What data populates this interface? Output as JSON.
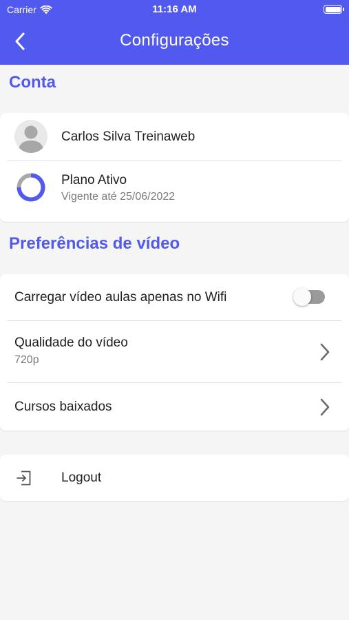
{
  "status_bar": {
    "carrier": "Carrier",
    "time": "11:16 AM"
  },
  "header": {
    "title": "Configurações"
  },
  "sections": {
    "account": {
      "title": "Conta"
    },
    "video": {
      "title": "Preferências de vídeo"
    }
  },
  "account": {
    "user_name": "Carlos Silva Treinaweb",
    "plan_title": "Plano Ativo",
    "plan_subtitle": "Vigente até 25/06/2022",
    "plan_progress_fraction": 0.75
  },
  "video_prefs": {
    "wifi_only_label": "Carregar vídeo aulas apenas no Wifi",
    "wifi_only_enabled": false,
    "quality_label": "Qualidade do vídeo",
    "quality_value": "720p",
    "downloads_label": "Cursos baixados"
  },
  "logout": {
    "label": "Logout"
  },
  "colors": {
    "accent": "#5259ee",
    "background": "#f5f5f5"
  }
}
